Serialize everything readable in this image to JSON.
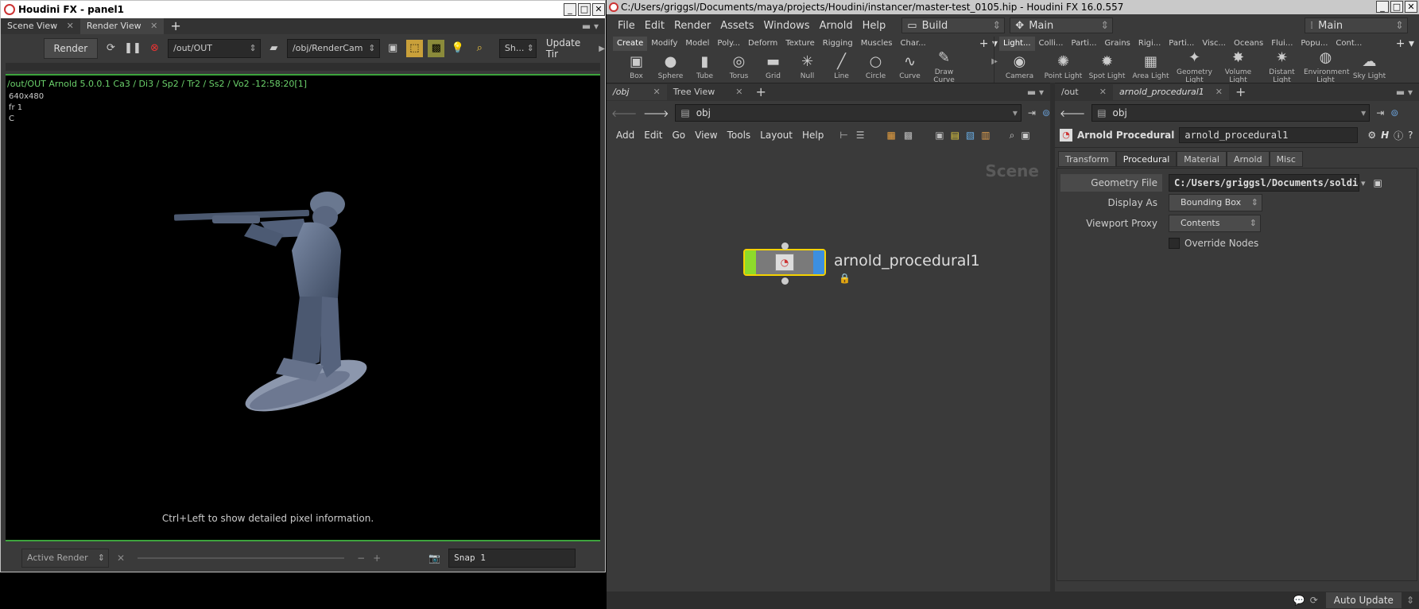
{
  "left_window": {
    "title": "Houdini FX - panel1",
    "tabs": [
      "Scene View",
      "Render View"
    ],
    "toolbar": {
      "render_label": "Render",
      "output_path": "/out/OUT",
      "camera_path": "/obj/RenderCam",
      "show_label": "Sh...",
      "update_label": "Update Tir"
    },
    "viewport": {
      "header": "/out/OUT  Arnold 5.0.0.1  Ca3 / Di3 / Sp2 / Tr2 / Ss2 / Vo2 -12:58:20[1]",
      "resolution": "640x480",
      "frame": "fr 1",
      "channel": "C",
      "hint": "Ctrl+Left to show detailed pixel information."
    },
    "bottom": {
      "active_render": "Active Render",
      "snap": "Snap  1"
    }
  },
  "main_window": {
    "title": "C:/Users/griggsl/Documents/maya/projects/Houdini/instancer/master-test_0105.hip - Houdini FX 16.0.557",
    "menu": [
      "File",
      "Edit",
      "Render",
      "Assets",
      "Windows",
      "Arnold",
      "Help"
    ],
    "desktop_build": "Build",
    "desktop_main": "Main",
    "desktop_main2": "Main",
    "shelf_tabs_left": [
      "Create",
      "Modify",
      "Model",
      "Poly...",
      "Deform",
      "Texture",
      "Rigging",
      "Muscles",
      "Char..."
    ],
    "shelf_tools_left": [
      {
        "label": "Box",
        "glyph": "▣"
      },
      {
        "label": "Sphere",
        "glyph": "●"
      },
      {
        "label": "Tube",
        "glyph": "▮"
      },
      {
        "label": "Torus",
        "glyph": "◎"
      },
      {
        "label": "Grid",
        "glyph": "▬"
      },
      {
        "label": "Null",
        "glyph": "✳"
      },
      {
        "label": "Line",
        "glyph": "╱"
      },
      {
        "label": "Circle",
        "glyph": "○"
      },
      {
        "label": "Curve",
        "glyph": "∿"
      },
      {
        "label": "Draw Curve",
        "glyph": "✎"
      }
    ],
    "shelf_tabs_right": [
      "Light...",
      "Colli...",
      "Parti...",
      "Grains",
      "Rigi...",
      "Parti...",
      "Visc...",
      "Oceans",
      "Flui...",
      "Popu...",
      "Cont..."
    ],
    "shelf_tools_right": [
      {
        "label": "Camera",
        "glyph": "◉"
      },
      {
        "label": "Point Light",
        "glyph": "✺"
      },
      {
        "label": "Spot Light",
        "glyph": "✹"
      },
      {
        "label": "Area Light",
        "glyph": "▦"
      },
      {
        "label": "Geometry Light",
        "glyph": "✦"
      },
      {
        "label": "Volume Light",
        "glyph": "✸"
      },
      {
        "label": "Distant Light",
        "glyph": "✷"
      },
      {
        "label": "Environment Light",
        "glyph": "◍"
      },
      {
        "label": "Sky Light",
        "glyph": "☁"
      }
    ],
    "network": {
      "tabs": [
        "/obj",
        "Tree View"
      ],
      "path": "obj",
      "menu": [
        "Add",
        "Edit",
        "Go",
        "View",
        "Tools",
        "Layout",
        "Help"
      ],
      "context_label": "Scene",
      "node_name": "arnold_procedural1"
    },
    "params": {
      "tabs": [
        "/out",
        "arnold_procedural1"
      ],
      "path": "obj",
      "node_type": "Arnold Procedural",
      "node_name": "arnold_procedural1",
      "param_tabs": [
        "Transform",
        "Procedural",
        "Material",
        "Arnold",
        "Misc"
      ],
      "geometry_file_label": "Geometry File",
      "geometry_file_value": "C:/Users/griggsl/Documents/soldier_h",
      "display_as_label": "Display As",
      "display_as_value": "Bounding Box",
      "viewport_proxy_label": "Viewport Proxy",
      "viewport_proxy_value": "Contents",
      "override_nodes_label": "Override Nodes"
    },
    "status": {
      "auto_update": "Auto Update"
    }
  }
}
